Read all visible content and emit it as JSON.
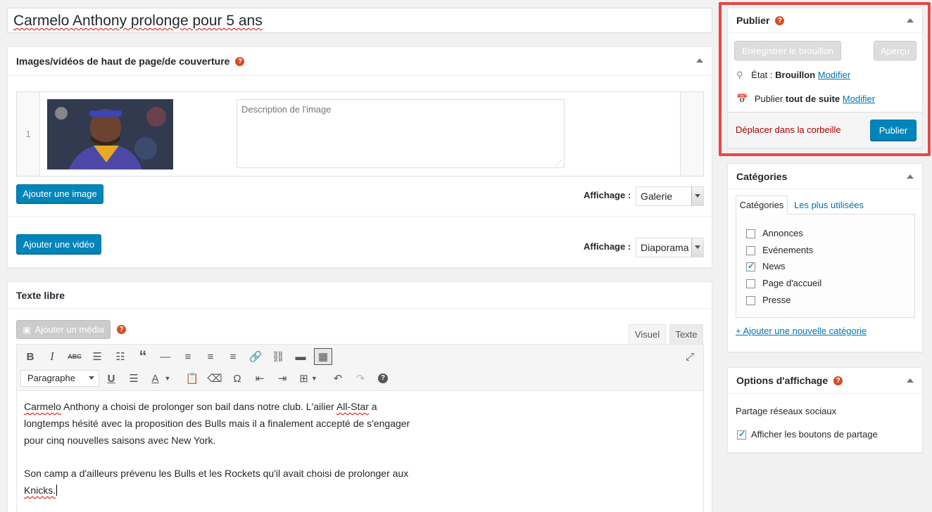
{
  "post": {
    "title": "Carmelo Anthony prolonge pour 5 ans"
  },
  "cover_box": {
    "title": "Images/vidéos de haut de page/de couverture",
    "row_number": "1",
    "description_placeholder": "Description de l'image",
    "add_image_label": "Ajouter une image",
    "add_video_label": "Ajouter une vidéo",
    "display_label": "Affichage :",
    "image_display_value": "Galerie",
    "video_display_value": "Diaporama"
  },
  "text_box": {
    "title": "Texte libre",
    "add_media_label": "Ajouter un média",
    "tab_visual": "Visuel",
    "tab_text": "Texte",
    "format_select": "Paragraphe",
    "content": {
      "p1_l1_a": "Carmelo",
      "p1_l1_b": " Anthony a choisi de prolonger son bail dans notre club. L'ailier ",
      "p1_l1_c": "All-Star",
      "p1_l1_d": " a",
      "p1_l2": "longtemps hésité avec la proposition des Bulls mais il a finalement accepté de s'engager",
      "p1_l3": "pour cinq nouvelles saisons avec New York.",
      "p2_l1": "Son camp a d'ailleurs prévenu les Bulls et les Rockets qu'il avait choisi de prolonger aux",
      "p2_l2": "Knicks."
    }
  },
  "publish_box": {
    "title": "Publier",
    "save_draft_label": "Enregistrer le brouillon",
    "preview_label": "Aperçu",
    "status_prefix": "État : ",
    "status_value": "Brouillon",
    "status_edit": "Modifier",
    "publish_prefix": "Publier ",
    "publish_value": "tout de suite",
    "publish_edit": "Modifier",
    "trash_label": "Déplacer dans la corbeille",
    "publish_button": "Publier",
    "highlight_color": "#e84646"
  },
  "categories_box": {
    "title": "Catégories",
    "tab_all": "Catégories",
    "tab_popular": "Les plus utilisées",
    "items": [
      {
        "label": "Annonces",
        "checked": false
      },
      {
        "label": "Evénements",
        "checked": false
      },
      {
        "label": "News",
        "checked": true
      },
      {
        "label": "Page d'accueil",
        "checked": false
      },
      {
        "label": "Presse",
        "checked": false
      }
    ],
    "add_new_label": "+ Ajouter une nouvelle catégorie"
  },
  "display_options_box": {
    "title": "Options d'affichage",
    "section_label": "Partage réseaux sociaux",
    "share_label": "Afficher les boutons de partage",
    "share_checked": true
  },
  "colors": {
    "accent": "#0085ba",
    "help_icon": "#d54e21",
    "trash": "#a00"
  }
}
